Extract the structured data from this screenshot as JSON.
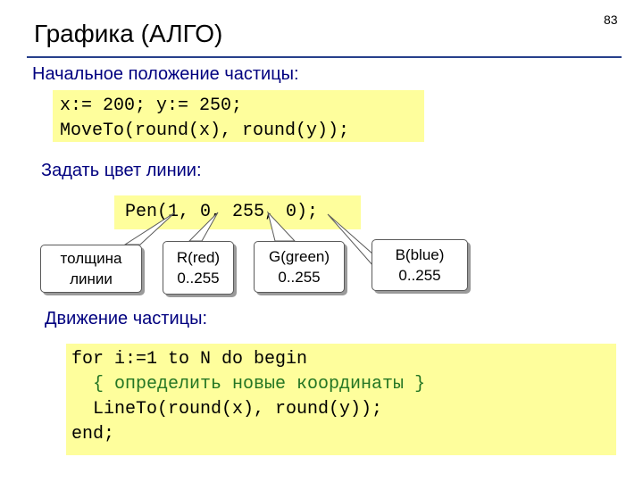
{
  "page_number": "83",
  "title": "Графика (АЛГО)",
  "section_initial": {
    "heading": "Начальное положение частицы:",
    "code_lines": [
      "x:= 200; y:= 250;",
      "MoveTo(round(x), round(y));"
    ]
  },
  "section_color": {
    "heading": "Задать цвет линии:",
    "code": "Pen(1, 0, 255, 0);",
    "callouts": [
      {
        "lines": [
          "толщина",
          "линии"
        ]
      },
      {
        "lines": [
          "R(red)",
          "0..255"
        ]
      },
      {
        "lines": [
          "G(green)",
          "0..255"
        ]
      },
      {
        "lines": [
          "B(blue)",
          "0..255"
        ]
      }
    ]
  },
  "section_motion": {
    "heading": "Движение частицы:",
    "code_lines": [
      "for i:=1 to N do begin",
      "  { определить новые координаты }",
      "  LineTo(round(x), round(y));",
      "end;"
    ]
  },
  "colors": {
    "heading": "#00007f",
    "code_bg": "#fefe9c",
    "comment": "#237523",
    "rule": "#27408b"
  }
}
